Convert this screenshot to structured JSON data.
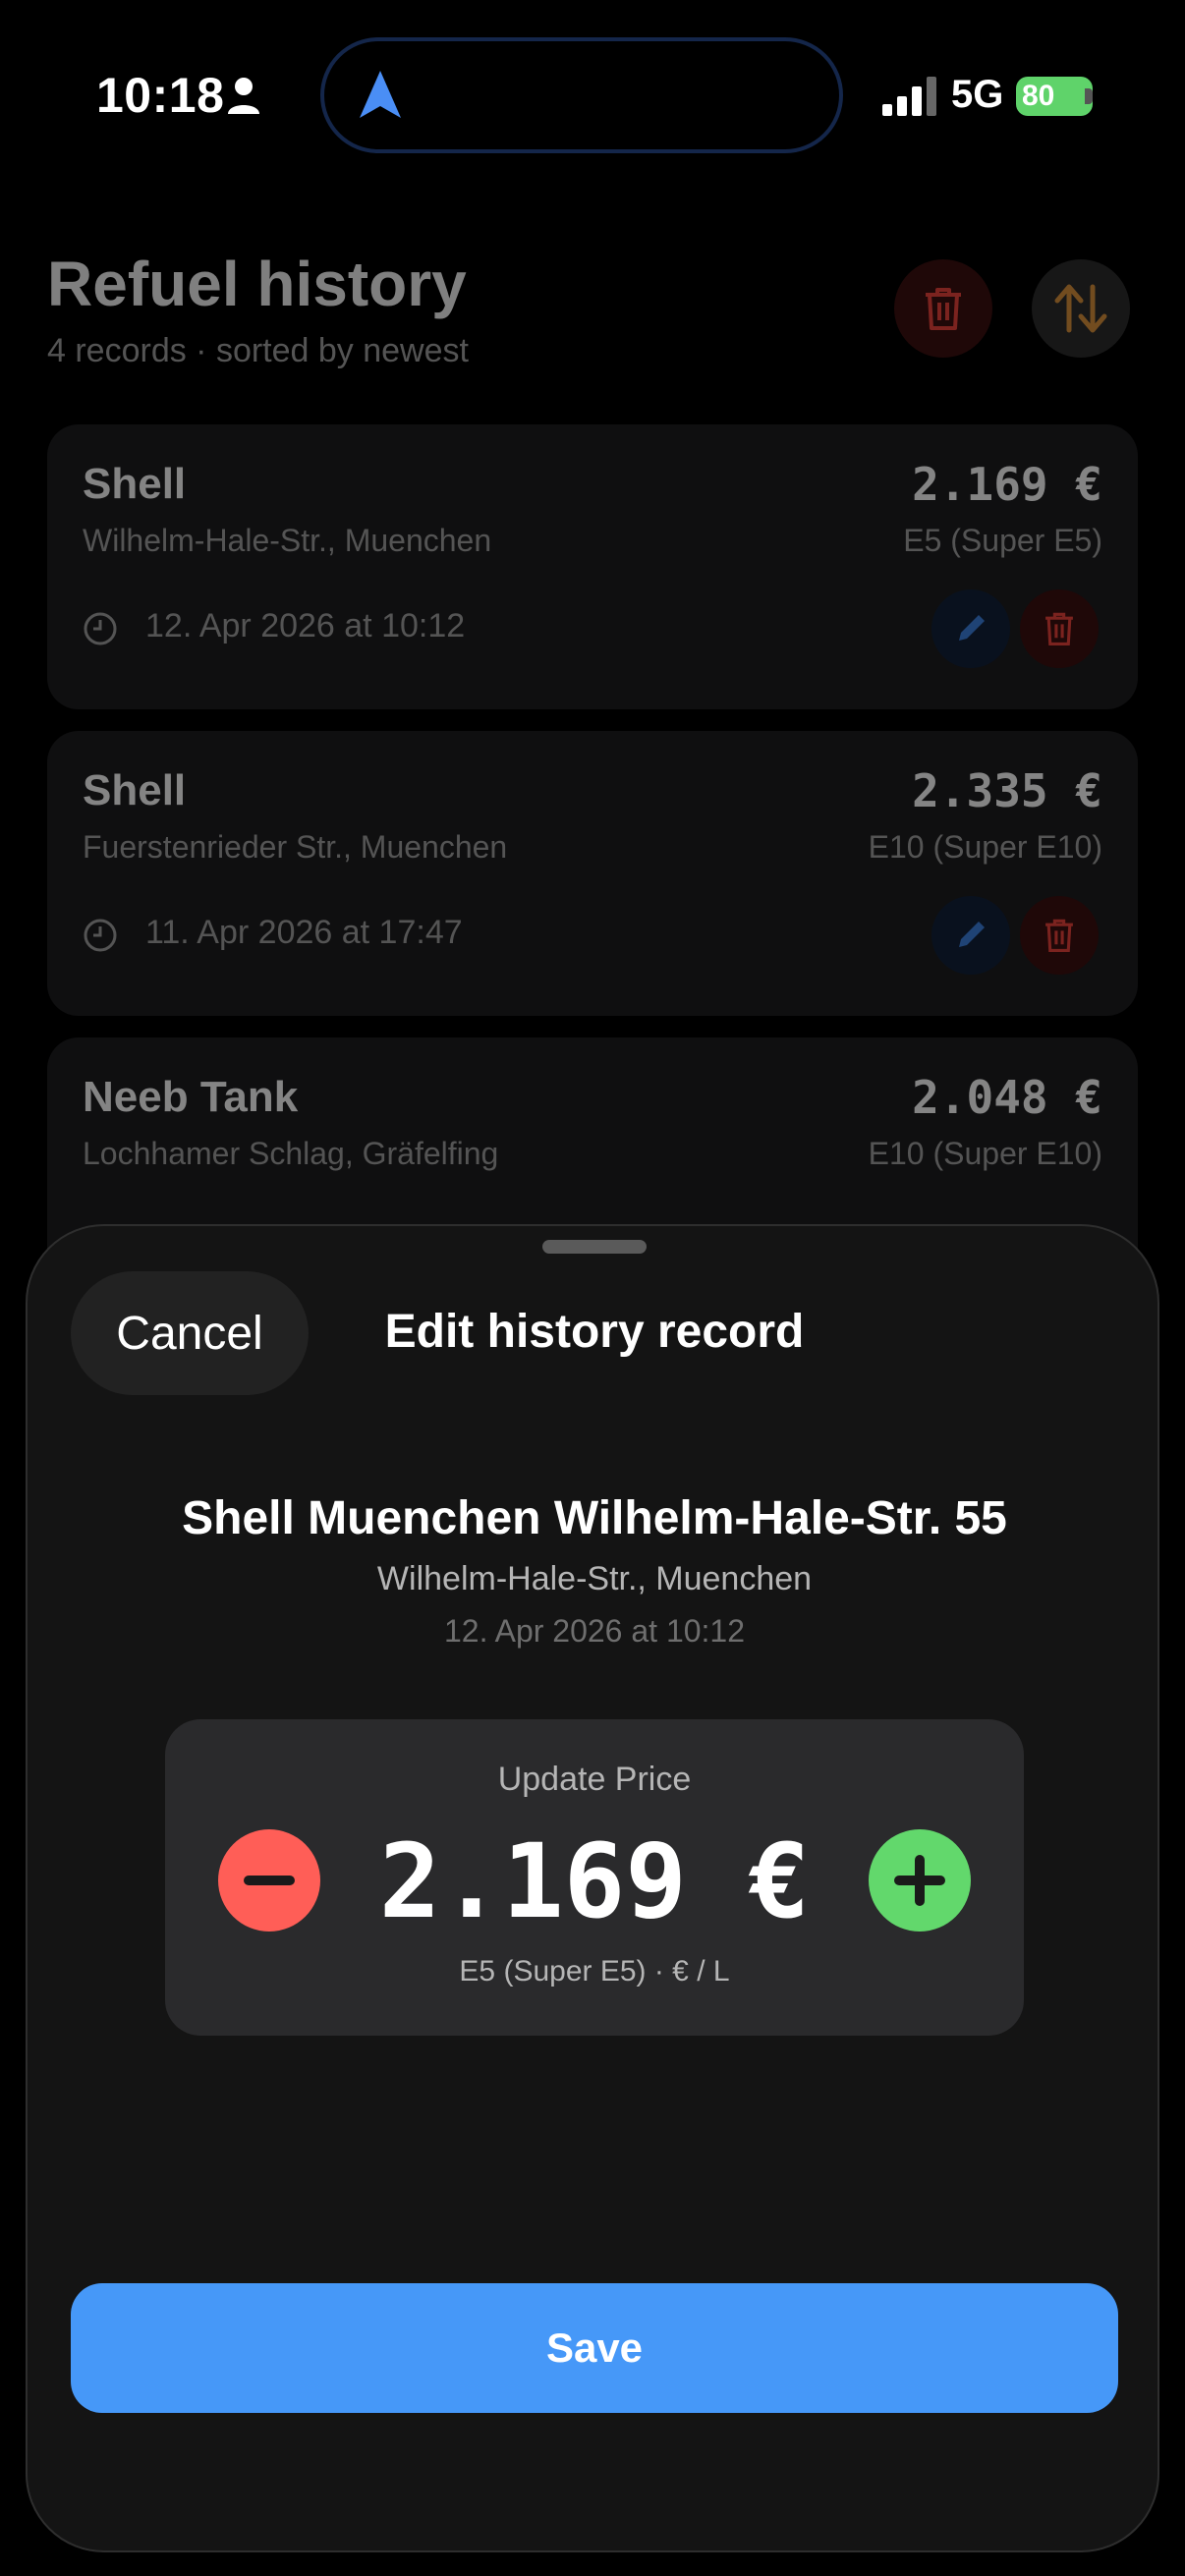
{
  "status_bar": {
    "time": "10:18",
    "network": "5G",
    "battery": "80"
  },
  "history": {
    "title": "Refuel history",
    "subtitle": "4 records · sorted by newest",
    "records": [
      {
        "name": "Shell",
        "address": "Wilhelm-Hale-Str., Muenchen",
        "price": "2.169 €",
        "fuel": "E5 (Super E5)",
        "date": "12. Apr 2026 at 10:12"
      },
      {
        "name": "Shell",
        "address": "Fuerstenrieder Str., Muenchen",
        "price": "2.335 €",
        "fuel": "E10 (Super E10)",
        "date": "11. Apr 2026 at 17:47"
      },
      {
        "name": "Neeb Tank",
        "address": "Lochhamer Schlag, Gräfelfing",
        "price": "2.048 €",
        "fuel": "E10 (Super E10)"
      }
    ]
  },
  "sheet": {
    "cancel_label": "Cancel",
    "title": "Edit history record",
    "station_name": "Shell Muenchen Wilhelm-Hale-Str. 55",
    "station_address": "Wilhelm-Hale-Str., Muenchen",
    "station_date": "12. Apr 2026 at 10:12",
    "price_label": "Update Price",
    "price_value": "2.169 €",
    "price_unit": "E5 (Super E5) · € / L",
    "save_label": "Save"
  },
  "colors": {
    "accent": "#4698f8",
    "decrease": "#ff5e57",
    "increase": "#62d86c",
    "danger": "#e0403a"
  },
  "icons": [
    "person-icon",
    "navigation-arrow-icon",
    "signal-icon",
    "battery-icon",
    "trash-icon",
    "sort-icon",
    "clock-icon",
    "pencil-icon",
    "minus-icon",
    "plus-icon"
  ]
}
